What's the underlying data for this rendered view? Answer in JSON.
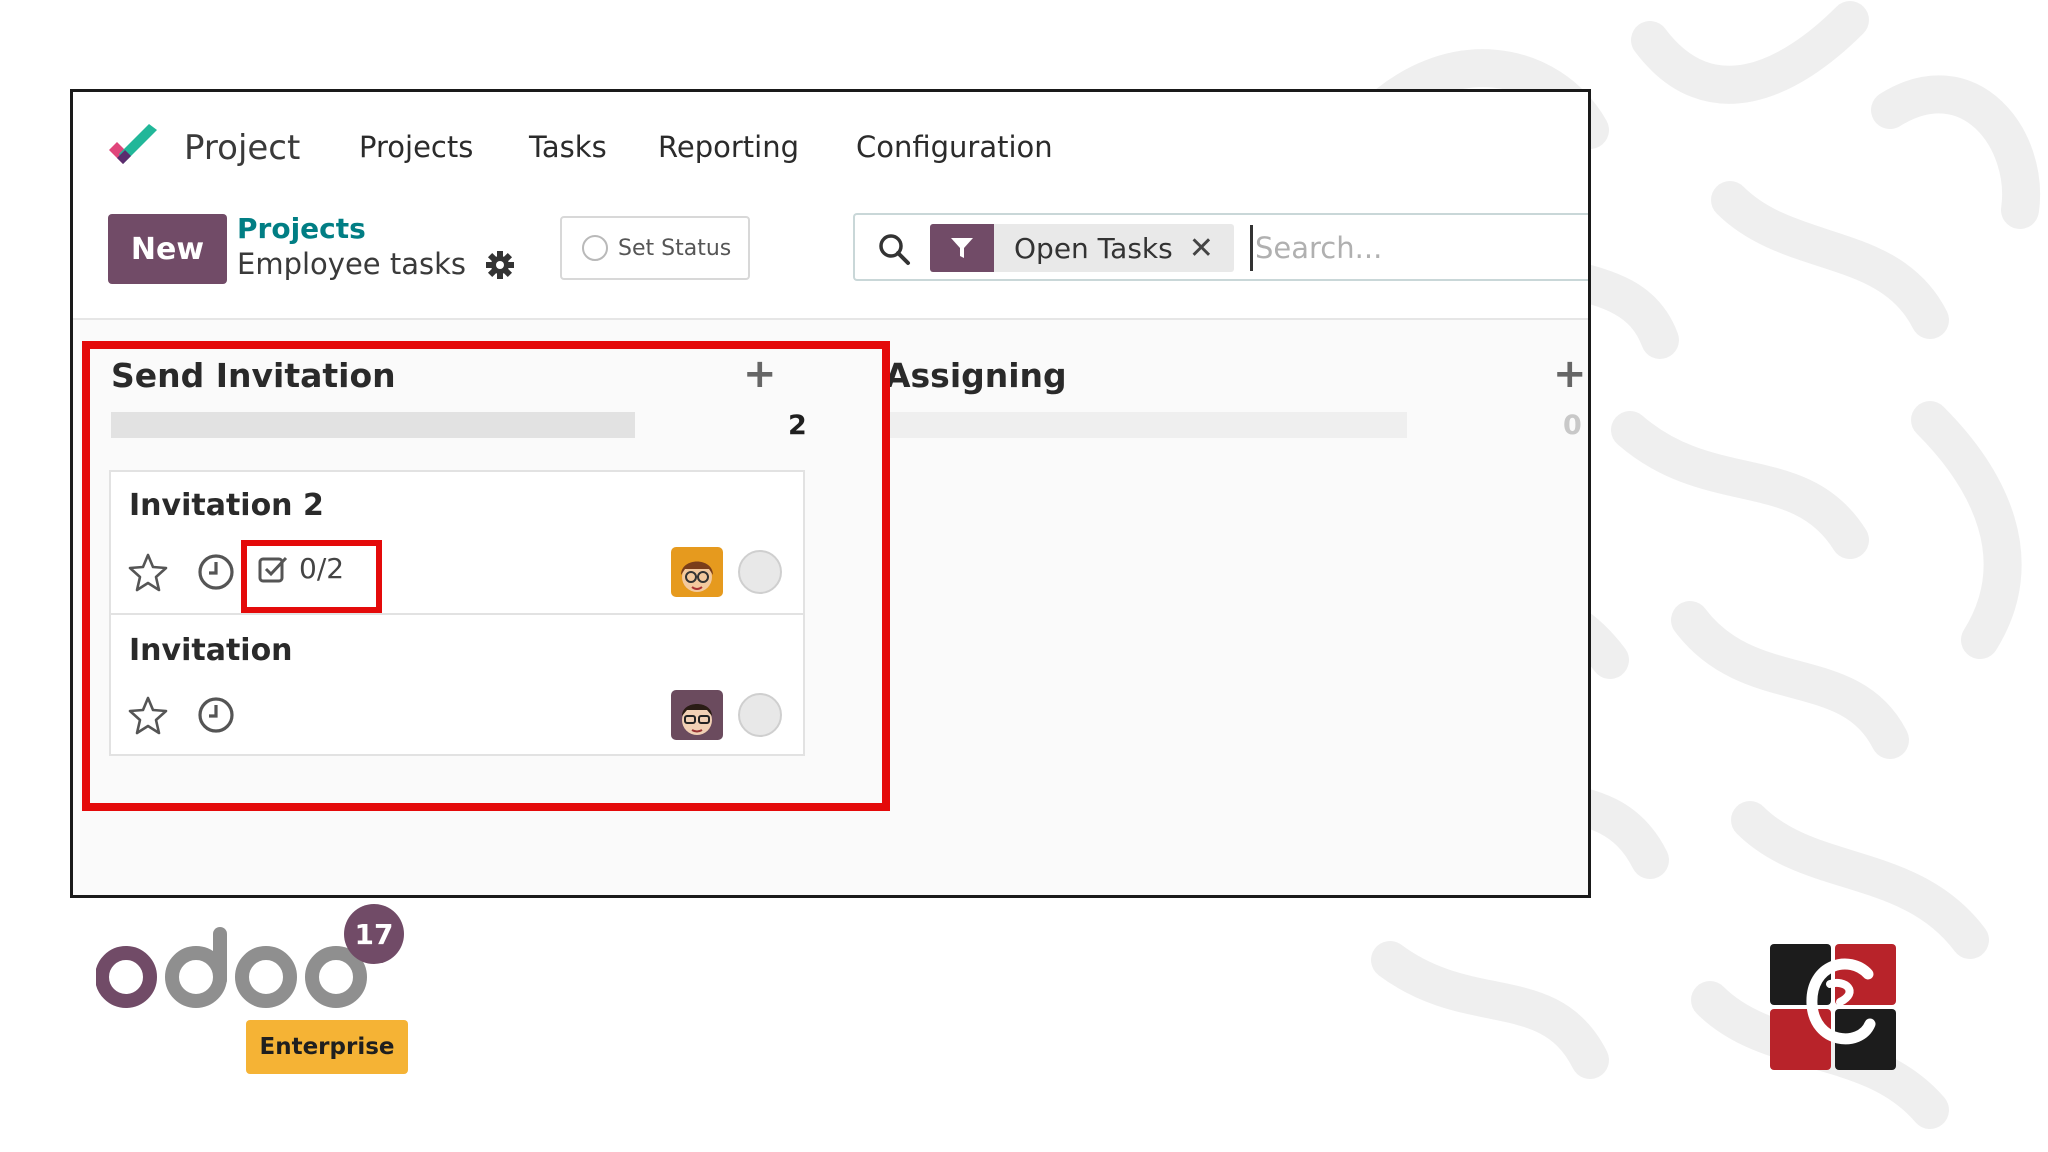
{
  "navbar": {
    "app_title": "Project",
    "items": [
      {
        "label": "Projects"
      },
      {
        "label": "Tasks"
      },
      {
        "label": "Reporting"
      },
      {
        "label": "Configuration"
      }
    ]
  },
  "control_panel": {
    "new_label": "New",
    "breadcrumb_parent": "Projects",
    "breadcrumb_current": "Employee tasks",
    "set_status_label": "Set Status"
  },
  "search": {
    "facet_icon": "filter-icon",
    "facet_label": "Open Tasks",
    "facet_remove": "✕",
    "placeholder": "Search..."
  },
  "kanban": {
    "columns": [
      {
        "title": "Send Invitation",
        "count": "2",
        "cards": [
          {
            "title": "Invitation 2",
            "checklist": "0/2",
            "avatar": "avatar-woman-icon"
          },
          {
            "title": "Invitation",
            "checklist": "",
            "avatar": "avatar-man-glasses-icon"
          }
        ]
      },
      {
        "title": "Assigning",
        "count": "0",
        "cards": []
      }
    ]
  },
  "branding": {
    "version": "17",
    "edition": "Enterprise"
  },
  "colors": {
    "primary": "#714b67",
    "link": "#017e84",
    "highlight": "#e40a0a",
    "edition_badge": "#f5b335"
  }
}
